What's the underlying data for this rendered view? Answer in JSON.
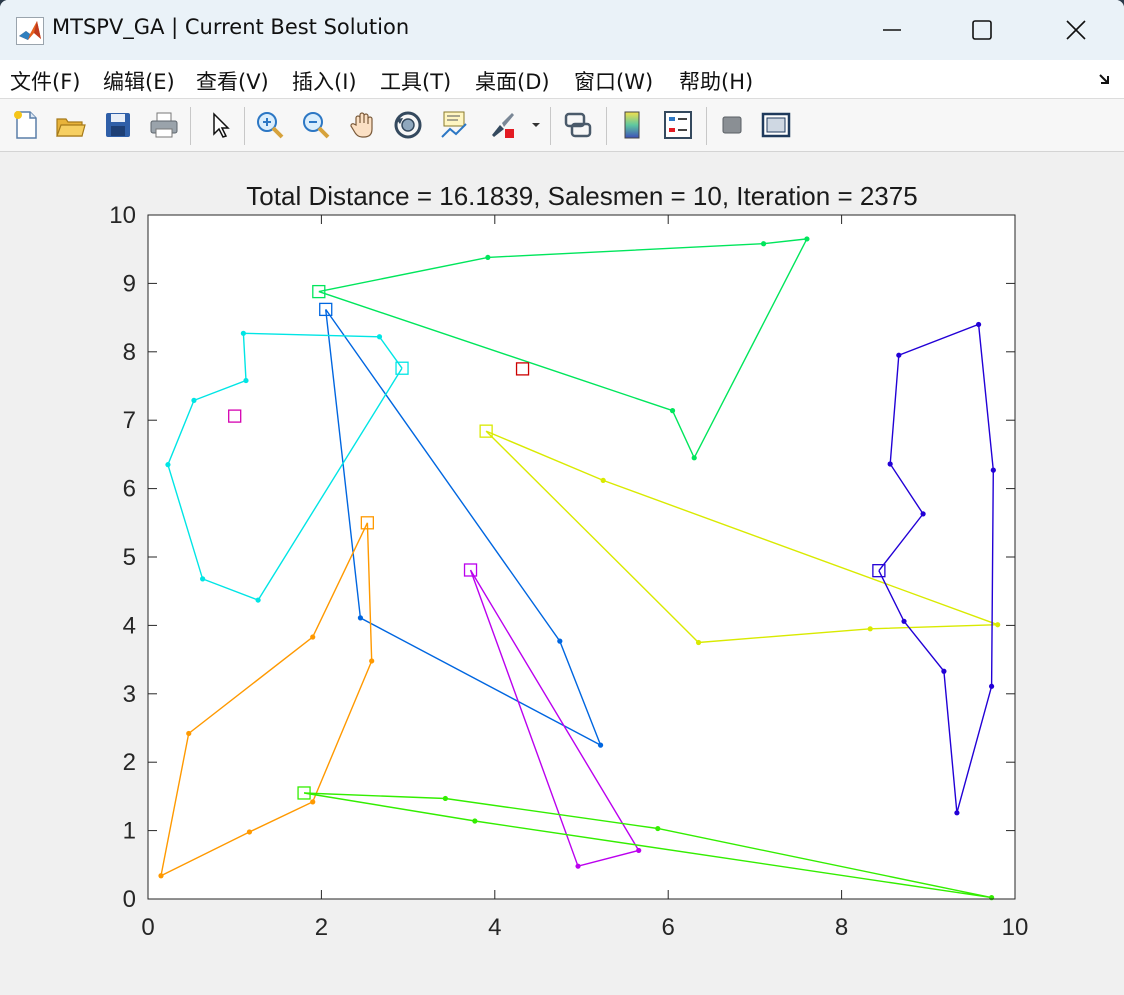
{
  "window": {
    "title": "MTSPV_GA | Current Best Solution",
    "minimize_symbol": "—",
    "maximize_symbol": "☐",
    "close_symbol": "✕"
  },
  "menu": [
    {
      "label": "文件(F)"
    },
    {
      "label": "编辑(E)"
    },
    {
      "label": "查看(V)"
    },
    {
      "label": "插入(I)"
    },
    {
      "label": "工具(T)"
    },
    {
      "label": "桌面(D)"
    },
    {
      "label": "窗口(W)"
    },
    {
      "label": "帮助(H)"
    }
  ],
  "toolbar_icons": [
    "new-figure-icon",
    "open-folder-icon",
    "save-icon",
    "print-icon",
    "pointer-icon",
    "zoom-in-icon",
    "zoom-out-icon",
    "pan-hand-icon",
    "rotate-3d-icon",
    "data-cursor-icon",
    "brush-icon",
    "link-plot-icon",
    "colorbar-icon",
    "legend-icon",
    "hide-plot-tools-icon",
    "show-plot-tools-icon"
  ],
  "chart_data": {
    "type": "line",
    "title": "Total Distance = 16.1839, Salesmen = 10, Iteration = 2375",
    "xlim": [
      0,
      10
    ],
    "ylim": [
      0,
      10
    ],
    "xticks": [
      0,
      2,
      4,
      6,
      8,
      10
    ],
    "yticks": [
      0,
      1,
      2,
      3,
      4,
      5,
      6,
      7,
      8,
      9,
      10
    ],
    "grid": false,
    "series": [
      {
        "color": "#00e65c",
        "start": [
          1.97,
          8.88
        ],
        "route": [
          [
            1.97,
            8.88
          ],
          [
            3.92,
            9.38
          ],
          [
            7.1,
            9.58
          ],
          [
            7.6,
            9.65
          ],
          [
            6.3,
            6.45
          ],
          [
            6.05,
            7.14
          ],
          [
            1.97,
            8.88
          ]
        ]
      },
      {
        "color": "#0066e0",
        "start": [
          2.05,
          8.62
        ],
        "route": [
          [
            2.05,
            8.62
          ],
          [
            4.75,
            3.77
          ],
          [
            5.22,
            2.25
          ],
          [
            2.45,
            4.11
          ],
          [
            2.05,
            8.62
          ]
        ]
      },
      {
        "color": "#00e5e5",
        "start": [
          2.93,
          7.76
        ],
        "route": [
          [
            2.93,
            7.76
          ],
          [
            2.67,
            8.22
          ],
          [
            1.1,
            8.27
          ],
          [
            1.13,
            7.58
          ],
          [
            0.53,
            7.29
          ],
          [
            0.23,
            6.35
          ],
          [
            0.63,
            4.68
          ],
          [
            1.27,
            4.37
          ],
          [
            2.93,
            7.76
          ]
        ]
      },
      {
        "color": "#cc0000",
        "start": [
          4.32,
          7.75
        ],
        "route": []
      },
      {
        "color": "#d400b0",
        "start": [
          1.0,
          7.06
        ],
        "route": []
      },
      {
        "color": "#d9ea00",
        "start": [
          3.9,
          6.84
        ],
        "route": [
          [
            3.9,
            6.84
          ],
          [
            5.25,
            6.12
          ],
          [
            9.8,
            4.01
          ],
          [
            8.33,
            3.95
          ],
          [
            6.35,
            3.75
          ],
          [
            3.9,
            6.84
          ]
        ]
      },
      {
        "color": "#ff9900",
        "start": [
          2.53,
          5.5
        ],
        "route": [
          [
            2.53,
            5.5
          ],
          [
            1.9,
            3.83
          ],
          [
            0.47,
            2.42
          ],
          [
            0.15,
            0.34
          ],
          [
            1.17,
            0.98
          ],
          [
            1.9,
            1.42
          ],
          [
            2.58,
            3.48
          ],
          [
            2.53,
            5.5
          ]
        ]
      },
      {
        "color": "#2200d6",
        "start": [
          8.43,
          4.8
        ],
        "route": [
          [
            8.43,
            4.8
          ],
          [
            8.94,
            5.63
          ],
          [
            8.56,
            6.36
          ],
          [
            8.66,
            7.95
          ],
          [
            9.58,
            8.4
          ],
          [
            9.75,
            6.27
          ],
          [
            9.73,
            3.11
          ],
          [
            9.33,
            1.26
          ],
          [
            9.18,
            3.33
          ],
          [
            8.72,
            4.06
          ],
          [
            8.43,
            4.8
          ]
        ]
      },
      {
        "color": "#bb00ee",
        "start": [
          3.72,
          4.81
        ],
        "route": [
          [
            3.72,
            4.81
          ],
          [
            5.66,
            0.71
          ],
          [
            4.96,
            0.48
          ],
          [
            3.72,
            4.81
          ]
        ]
      },
      {
        "color": "#33ee00",
        "start": [
          1.8,
          1.55
        ],
        "route": [
          [
            1.8,
            1.55
          ],
          [
            3.43,
            1.47
          ],
          [
            5.88,
            1.03
          ],
          [
            9.73,
            0.02
          ],
          [
            3.77,
            1.14
          ],
          [
            1.8,
            1.55
          ]
        ]
      }
    ]
  }
}
